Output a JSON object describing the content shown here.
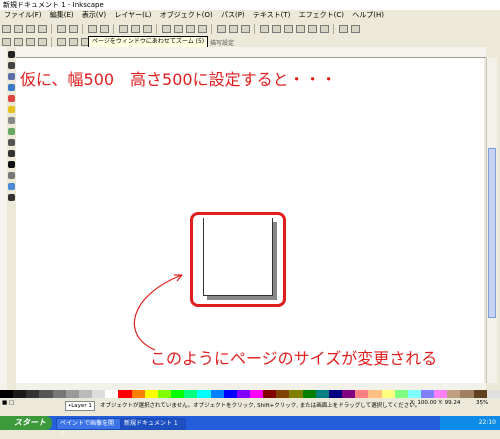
{
  "window": {
    "title": "新規ドキュメント 1 - Inkscape"
  },
  "menu": [
    "ファイル(F)",
    "編集(E)",
    "表示(V)",
    "レイヤー(L)",
    "オブジェクト(O)",
    "パス(P)",
    "テキスト(T)",
    "エフェクト(C)",
    "ヘルプ(H)"
  ],
  "tooltip": "ページをウィンドウにあわせてズーム (5)",
  "tool_controls": "描写設定",
  "canvas": {
    "caption_top": "仮に、幅500　高さ500に設定すると・・・",
    "caption_bottom": "このようにページのサイズが変更される"
  },
  "status": {
    "layer": "•Layer 1",
    "message": "オブジェクトが選択されていません。オブジェクトをクリック, Shift+クリック, または画面上をドラッグして選択してください。",
    "coords": "X: 100.00  Y: 99.24",
    "zoom": "35%"
  },
  "taskbar": {
    "start": "スタート",
    "tasks": [
      "ペイントで画像を開く",
      "新規ドキュメント 1"
    ],
    "clock": "22:10"
  },
  "colors": {
    "accent": "#e01e1e",
    "taskbar": "#245edb"
  }
}
